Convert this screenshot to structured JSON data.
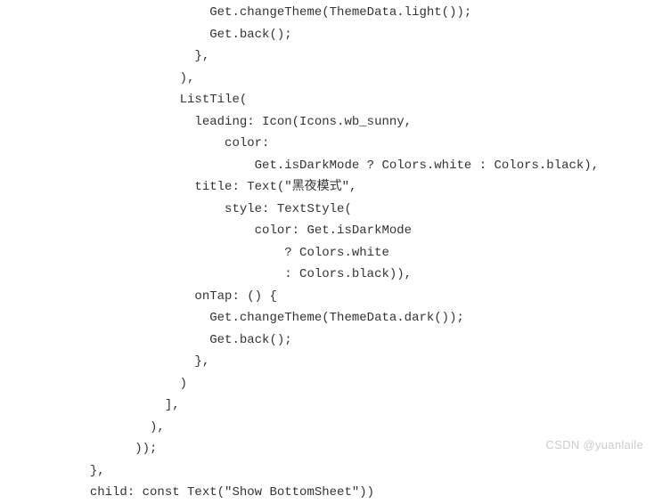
{
  "code": {
    "lines": [
      "                            Get.changeTheme(ThemeData.light());",
      "                            Get.back();",
      "                          },",
      "                        ),",
      "                        ListTile(",
      "                          leading: Icon(Icons.wb_sunny,",
      "                              color:",
      "                                  Get.isDarkMode ? Colors.white : Colors.black),",
      "                          title: Text(\"黑夜模式\",",
      "                              style: TextStyle(",
      "                                  color: Get.isDarkMode",
      "                                      ? Colors.white",
      "                                      : Colors.black)),",
      "                          onTap: () {",
      "                            Get.changeTheme(ThemeData.dark());",
      "                            Get.back();",
      "                          },",
      "                        )",
      "                      ],",
      "                    ),",
      "                  ));",
      "            },",
      "            child: const Text(\"Show BottomSheet\"))"
    ]
  },
  "watermark": "CSDN @yuanlaile"
}
